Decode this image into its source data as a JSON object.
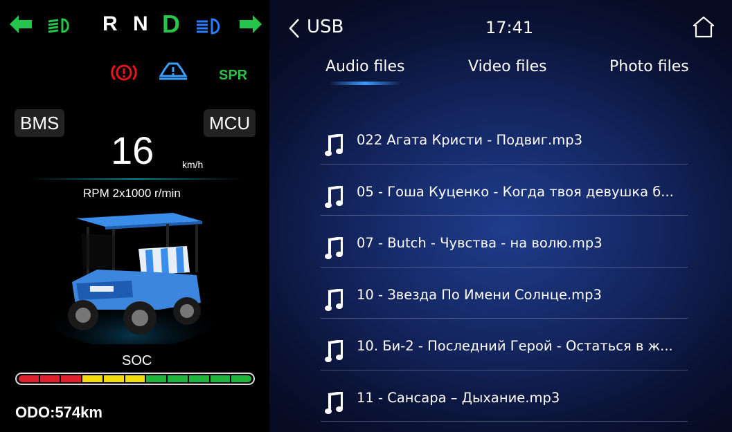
{
  "cluster": {
    "gears": [
      "R",
      "N",
      "D"
    ],
    "active_gear": "D",
    "warning_label": "SPR",
    "bms_label": "BMS",
    "mcu_label": "MCU",
    "speed": "16",
    "speed_unit": "km/h",
    "rpm_text": "RPM 2x1000 r/min",
    "soc_label": "SOC",
    "soc_segments": [
      "#e0202a",
      "#e0202a",
      "#e0202a",
      "#f2dc0c",
      "#f2dc0c",
      "#f2dc0c",
      "#1fb53c",
      "#1fb53c",
      "#1fb53c",
      "#1fb53c",
      "#1fb53c"
    ],
    "odo_text": "ODO:574km",
    "colors": {
      "green": "#25c44a",
      "red": "#e4151f",
      "blue": "#3aa0ff",
      "highbeam": "#2a7cff"
    }
  },
  "media": {
    "back_label": "USB",
    "clock": "17:41",
    "tabs": [
      {
        "label": "Audio files",
        "active": true
      },
      {
        "label": "Video files",
        "active": false
      },
      {
        "label": "Photo files",
        "active": false
      }
    ],
    "files": [
      "022 Агата Кристи - Подвиг.mp3",
      "05 - Гоша Куценко - Когда твоя девушка б...",
      "07 - Butch - Чувства - на волю.mp3",
      "10 - Звезда По Имени Солнце.mp3",
      "10. Би-2 - Последний Герой - Остаться в ж...",
      "11 - Сансара – Дыхание.mp3"
    ],
    "icons": {
      "back": "chevron-left-icon",
      "home": "home-icon",
      "file": "music-note-icon"
    }
  }
}
